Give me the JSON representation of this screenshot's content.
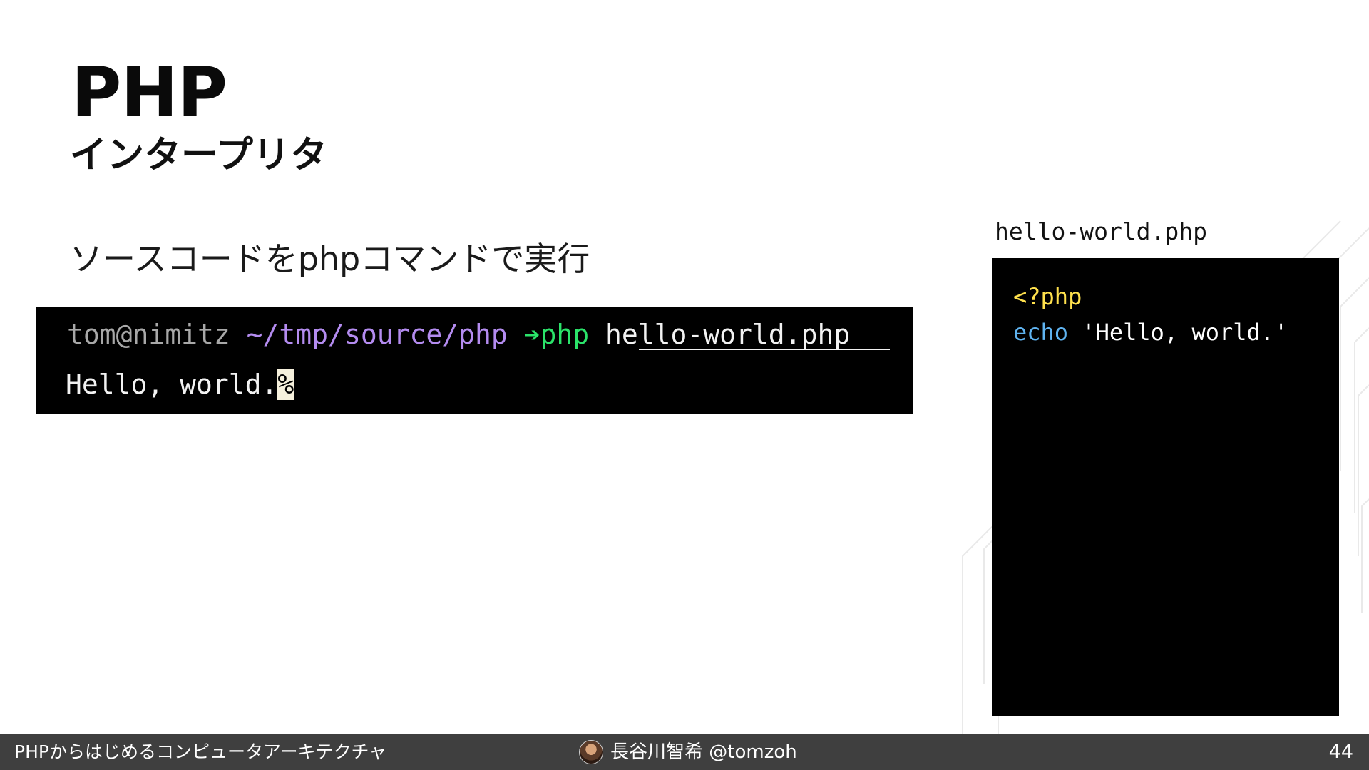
{
  "slide": {
    "title": "PHP",
    "subtitle": "インタープリタ",
    "lead": "ソースコードをphpコマンドで実行"
  },
  "terminal": {
    "user_host": "tom@nimitz",
    "path": "~/tmp/source/php",
    "prompt_arrow": "➔",
    "command": "php",
    "argument": "hello-world.php",
    "output": "Hello, world.",
    "cursor_char": "%"
  },
  "code_file": {
    "filename": "hello-world.php",
    "lines": {
      "open_tag": "<?php",
      "keyword": "echo",
      "string": "'Hello, world.'"
    }
  },
  "footer": {
    "deck_title": "PHPからはじめるコンピュータアーキテクチャ",
    "author": "長谷川智希 @tomzoh",
    "page_number": "44"
  },
  "colors": {
    "terminal_bg": "#000000",
    "prompt_user": "#a8a8a8",
    "prompt_path": "#b48cf0",
    "prompt_command": "#2be36a",
    "code_tag": "#ffe14d",
    "code_keyword": "#5fb3f0",
    "footer_bg": "#3f3f3f"
  }
}
